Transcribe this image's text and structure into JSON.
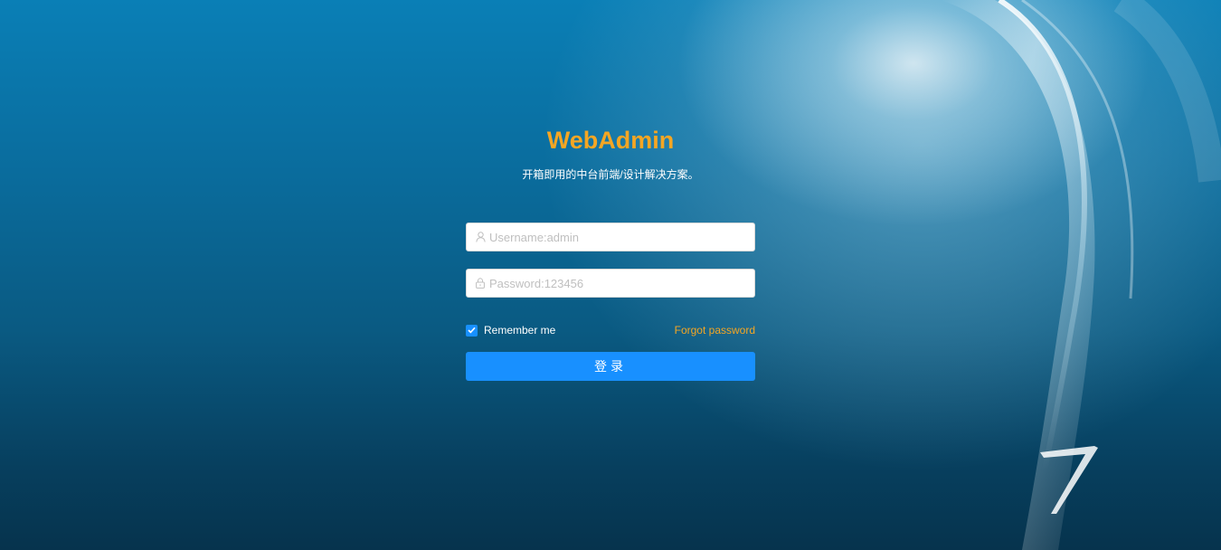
{
  "brand": {
    "title": "WebAdmin",
    "subtitle": "开箱即用的中台前端/设计解决方案。"
  },
  "form": {
    "username_placeholder": "Username:admin",
    "username_value": "",
    "password_placeholder": "Password:123456",
    "password_value": "",
    "remember_label": "Remember me",
    "remember_checked": true,
    "forgot_label": "Forgot password",
    "submit_label": "登录"
  },
  "colors": {
    "accent": "#f5a623",
    "primary": "#1890ff"
  },
  "icons": {
    "username": "user-icon",
    "password": "lock-icon",
    "checkbox": "check-icon"
  }
}
